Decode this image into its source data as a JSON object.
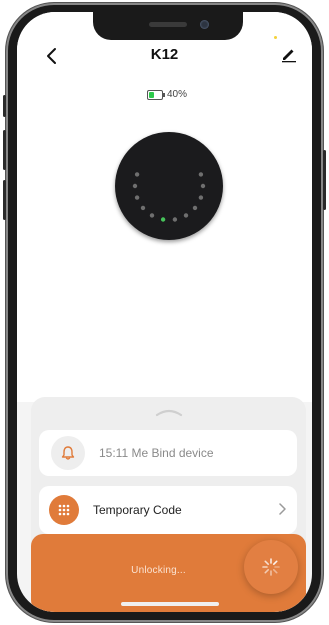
{
  "header": {
    "title": "K12",
    "battery_percent": "40%",
    "battery_level": 0.4
  },
  "history": {
    "text": "15:11 Me  Bind device"
  },
  "temporary_code": {
    "label": "Temporary Code"
  },
  "unlock": {
    "status": "Unlocking..."
  },
  "colors": {
    "accent": "#e07b3a",
    "battery_green": "#2cc94b",
    "device_dark": "#1b1b1d"
  },
  "icons": [
    "back-arrow-icon",
    "edit-pencil-icon",
    "battery-icon",
    "bell-icon",
    "keypad-grid-icon",
    "chevron-right-icon",
    "loading-spinner-icon",
    "chevron-up-icon"
  ]
}
